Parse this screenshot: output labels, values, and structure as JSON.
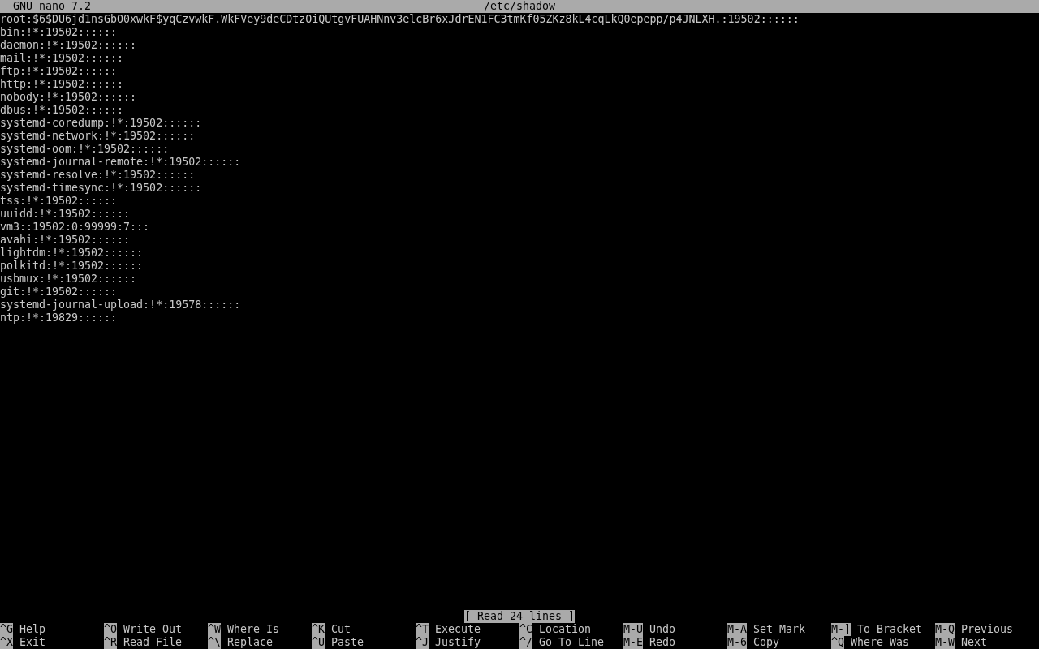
{
  "title_bar": {
    "app": "GNU nano 7.2",
    "file": "/etc/shadow"
  },
  "lines": [
    "root:$6$DU6jd1nsGbO0xwkF$yqCzvwkF.WkFVey9deCDtzOiQUtgvFUAHNnv3elcBr6xJdrEN1FC3tmKf05ZKz8kL4cqLkQ0epepp/p4JNLXH.:19502::::::",
    "bin:!*:19502::::::",
    "daemon:!*:19502::::::",
    "mail:!*:19502::::::",
    "ftp:!*:19502::::::",
    "http:!*:19502::::::",
    "nobody:!*:19502::::::",
    "dbus:!*:19502::::::",
    "systemd-coredump:!*:19502::::::",
    "systemd-network:!*:19502::::::",
    "systemd-oom:!*:19502::::::",
    "systemd-journal-remote:!*:19502::::::",
    "systemd-resolve:!*:19502::::::",
    "systemd-timesync:!*:19502::::::",
    "tss:!*:19502::::::",
    "uuidd:!*:19502::::::",
    "vm3::19502:0:99999:7:::",
    "avahi:!*:19502::::::",
    "lightdm:!*:19502::::::",
    "polkitd:!*:19502::::::",
    "usbmux:!*:19502::::::",
    "git:!*:19502::::::",
    "systemd-journal-upload:!*:19578::::::",
    "ntp:!*:19829::::::"
  ],
  "status": "[ Read 24 lines ]",
  "shortcuts": [
    {
      "key": "^G",
      "label": "Help"
    },
    {
      "key": "^O",
      "label": "Write Out"
    },
    {
      "key": "^W",
      "label": "Where Is"
    },
    {
      "key": "^K",
      "label": "Cut"
    },
    {
      "key": "^T",
      "label": "Execute"
    },
    {
      "key": "^C",
      "label": "Location"
    },
    {
      "key": "M-U",
      "label": "Undo"
    },
    {
      "key": "M-A",
      "label": "Set Mark"
    },
    {
      "key": "M-]",
      "label": "To Bracket"
    },
    {
      "key": "M-Q",
      "label": "Previous"
    },
    {
      "key": "^X",
      "label": "Exit"
    },
    {
      "key": "^R",
      "label": "Read File"
    },
    {
      "key": "^\\",
      "label": "Replace"
    },
    {
      "key": "^U",
      "label": "Paste"
    },
    {
      "key": "^J",
      "label": "Justify"
    },
    {
      "key": "^/",
      "label": "Go To Line"
    },
    {
      "key": "M-E",
      "label": "Redo"
    },
    {
      "key": "M-6",
      "label": "Copy"
    },
    {
      "key": "^Q",
      "label": "Where Was"
    },
    {
      "key": "M-W",
      "label": "Next"
    }
  ]
}
